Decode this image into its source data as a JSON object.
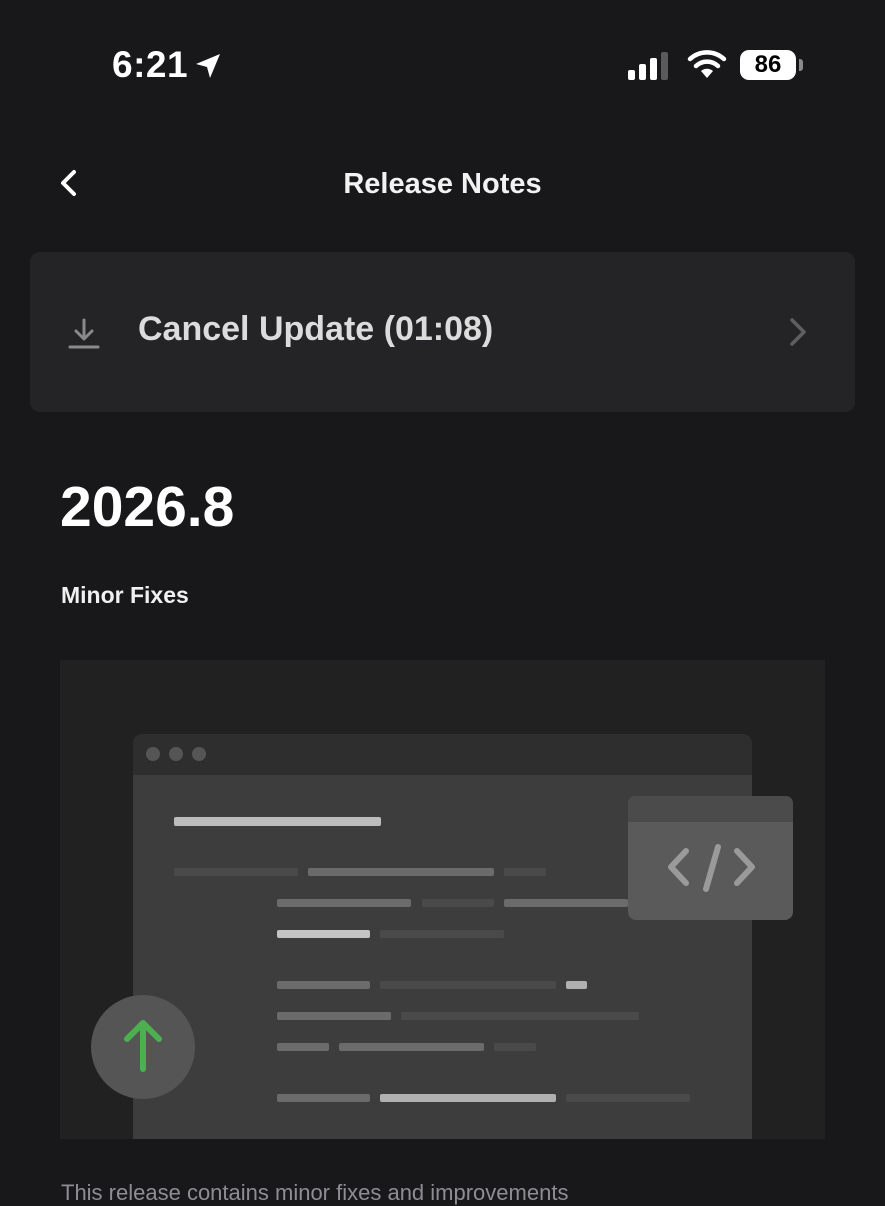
{
  "status_bar": {
    "time": "6:21",
    "battery_level": "86",
    "icons": [
      "location-arrow-icon",
      "cellular-signal-icon",
      "wifi-icon",
      "battery-icon"
    ]
  },
  "header": {
    "title": "Release Notes",
    "back_icon": "chevron-left-icon"
  },
  "update_card": {
    "label": "Cancel Update (01:08)",
    "icon": "download-icon",
    "trailing_icon": "chevron-right-icon"
  },
  "release": {
    "version": "2026.8",
    "subtitle": "Minor Fixes",
    "description": "This release contains minor fixes and improvements"
  },
  "illustration": {
    "icons": [
      "code-brackets-icon",
      "arrow-up-icon"
    ],
    "colors": {
      "background": "#212121",
      "window": "#3d3d3d",
      "window_titlebar": "#2e2e2e",
      "code_card": "#5a5a5a",
      "upgrade_circle": "#555555",
      "upgrade_arrow": "#4caf50"
    }
  },
  "colors": {
    "background": "#18181a",
    "card": "#242426",
    "text_primary": "#ffffff",
    "text_secondary": "#8e8e92"
  }
}
